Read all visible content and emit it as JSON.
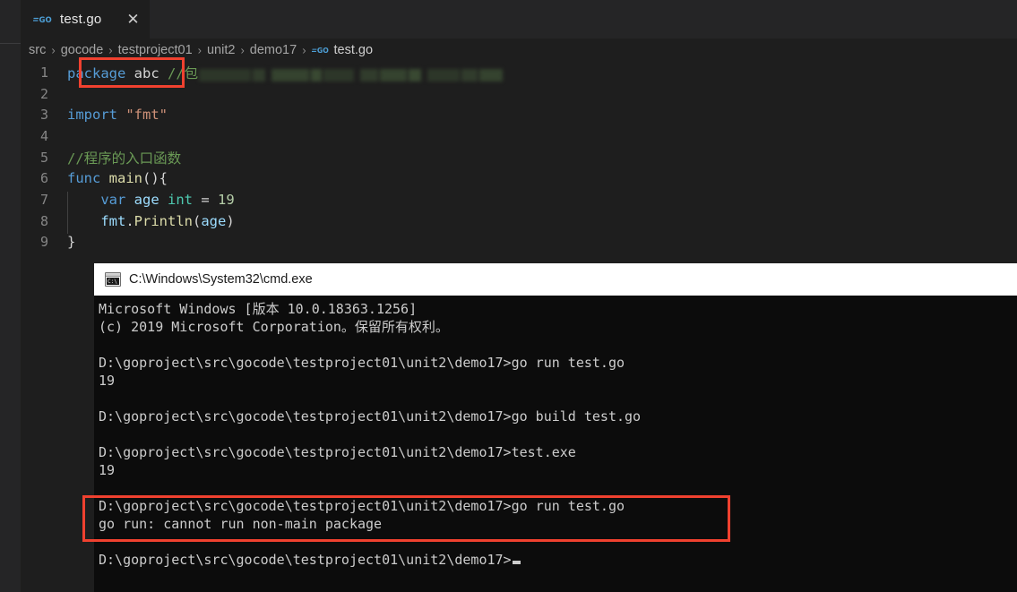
{
  "window": {
    "app": "Visual Studio Code",
    "background_color": "#1e1e1e"
  },
  "tabbar": {
    "tabs": [
      {
        "label": "test.go",
        "icon": "go-file-icon",
        "close_label": "✕",
        "active": true
      }
    ]
  },
  "breadcrumb": {
    "separator": "›",
    "items": [
      {
        "label": "src"
      },
      {
        "label": "gocode"
      },
      {
        "label": "testproject01"
      },
      {
        "label": "unit2"
      },
      {
        "label": "demo17"
      },
      {
        "label": "test.go",
        "icon": "go-file-icon"
      }
    ]
  },
  "editor": {
    "language": "go",
    "line_numbers": [
      "1",
      "2",
      "3",
      "4",
      "5",
      "6",
      "7",
      "8",
      "9"
    ],
    "lines": [
      {
        "n": "1",
        "tokens": [
          {
            "t": "package",
            "c": "t-kw"
          },
          {
            "t": " ",
            "c": "t-plain"
          },
          {
            "t": "abc",
            "c": "t-plain"
          },
          {
            "t": " ",
            "c": "t-plain"
          },
          {
            "t": "//包",
            "c": "t-com"
          },
          {
            "t": "[redacted]",
            "c": "redacted"
          }
        ]
      },
      {
        "n": "2",
        "tokens": []
      },
      {
        "n": "3",
        "tokens": [
          {
            "t": "import",
            "c": "t-kw"
          },
          {
            "t": " ",
            "c": "t-plain"
          },
          {
            "t": "\"fmt\"",
            "c": "t-str"
          }
        ]
      },
      {
        "n": "4",
        "tokens": []
      },
      {
        "n": "5",
        "tokens": [
          {
            "t": "//程序的入口函数",
            "c": "t-com"
          }
        ]
      },
      {
        "n": "6",
        "tokens": [
          {
            "t": "func",
            "c": "t-kw"
          },
          {
            "t": " ",
            "c": "t-plain"
          },
          {
            "t": "main",
            "c": "t-fn"
          },
          {
            "t": "(){",
            "c": "t-plain"
          }
        ]
      },
      {
        "n": "7",
        "indent": 1,
        "tokens": [
          {
            "t": "    ",
            "c": "t-plain"
          },
          {
            "t": "var",
            "c": "t-kw"
          },
          {
            "t": " ",
            "c": "t-plain"
          },
          {
            "t": "age",
            "c": "t-var"
          },
          {
            "t": " ",
            "c": "t-plain"
          },
          {
            "t": "int",
            "c": "t-type"
          },
          {
            "t": " = ",
            "c": "t-plain"
          },
          {
            "t": "19",
            "c": "t-num"
          }
        ]
      },
      {
        "n": "8",
        "indent": 1,
        "tokens": [
          {
            "t": "    ",
            "c": "t-plain"
          },
          {
            "t": "fmt",
            "c": "t-var"
          },
          {
            "t": ".",
            "c": "t-plain"
          },
          {
            "t": "Println",
            "c": "t-fn"
          },
          {
            "t": "(",
            "c": "t-plain"
          },
          {
            "t": "age",
            "c": "t-var"
          },
          {
            "t": ")",
            "c": "t-plain"
          }
        ]
      },
      {
        "n": "9",
        "tokens": [
          {
            "t": "}",
            "c": "t-plain"
          }
        ]
      }
    ]
  },
  "annotations": {
    "color": "#f0412f",
    "boxes": [
      {
        "id": "hl-package",
        "target": "package abc declaration"
      },
      {
        "id": "hl-error",
        "target": "go run: cannot run non-main package error"
      }
    ]
  },
  "terminal": {
    "title": "C:\\Windows\\System32\\cmd.exe",
    "icon": "cmd-console-icon",
    "title_bar_color": "#ffffff",
    "background_color": "#0c0c0c",
    "text_color": "#cccccc",
    "lines": [
      "Microsoft Windows [版本 10.0.18363.1256]",
      "(c) 2019 Microsoft Corporation。保留所有权利。",
      "",
      "D:\\goproject\\src\\gocode\\testproject01\\unit2\\demo17>go run test.go",
      "19",
      "",
      "D:\\goproject\\src\\gocode\\testproject01\\unit2\\demo17>go build test.go",
      "",
      "D:\\goproject\\src\\gocode\\testproject01\\unit2\\demo17>test.exe",
      "19",
      "",
      "D:\\goproject\\src\\gocode\\testproject01\\unit2\\demo17>go run test.go",
      "go run: cannot run non-main package",
      "",
      "D:\\goproject\\src\\gocode\\testproject01\\unit2\\demo17>"
    ],
    "prompt_cursor": true
  }
}
